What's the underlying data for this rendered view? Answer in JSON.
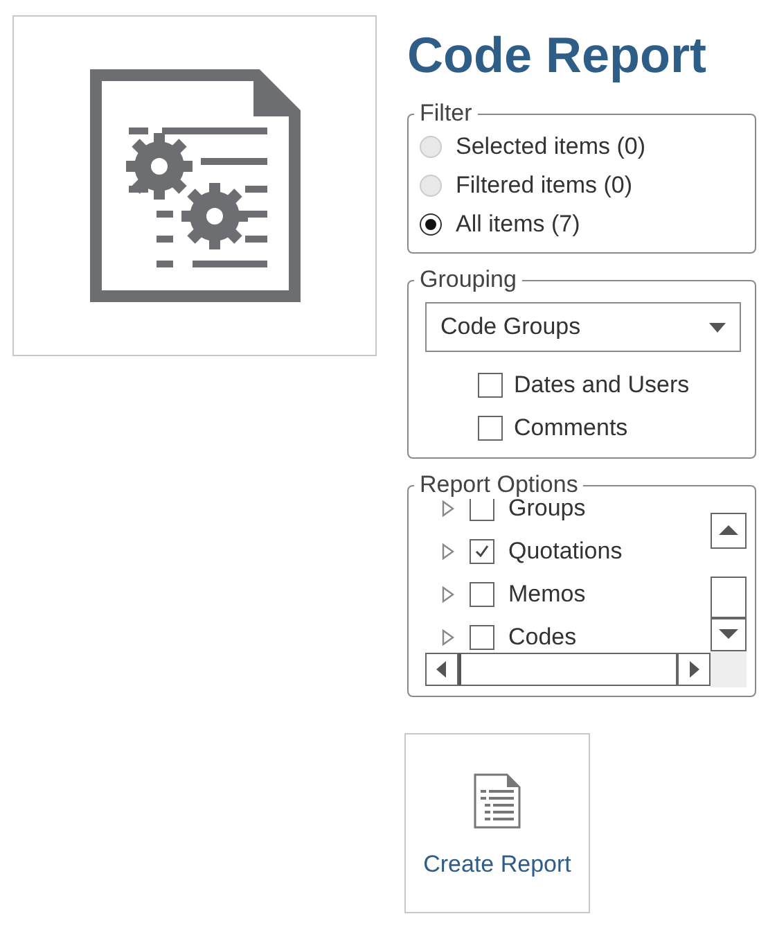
{
  "title": "Code Report",
  "filter": {
    "label": "Filter",
    "options": [
      {
        "label": "Selected items (0)",
        "selected": false,
        "disabled": true
      },
      {
        "label": "Filtered items (0)",
        "selected": false,
        "disabled": true
      },
      {
        "label": "All items (7)",
        "selected": true,
        "disabled": false
      }
    ]
  },
  "grouping": {
    "label": "Grouping",
    "dropdown": {
      "value": "Code Groups"
    },
    "options": [
      {
        "label": "Dates and Users",
        "checked": false
      },
      {
        "label": "Comments",
        "checked": false
      }
    ]
  },
  "report_options": {
    "label": "Report Options",
    "items": [
      {
        "label": "Groups",
        "checked": false,
        "expanded": false
      },
      {
        "label": "Quotations",
        "checked": true,
        "expanded": false
      },
      {
        "label": "Memos",
        "checked": false,
        "expanded": false
      },
      {
        "label": "Codes",
        "checked": false,
        "expanded": false
      }
    ]
  },
  "create_button": {
    "label": "Create Report"
  }
}
